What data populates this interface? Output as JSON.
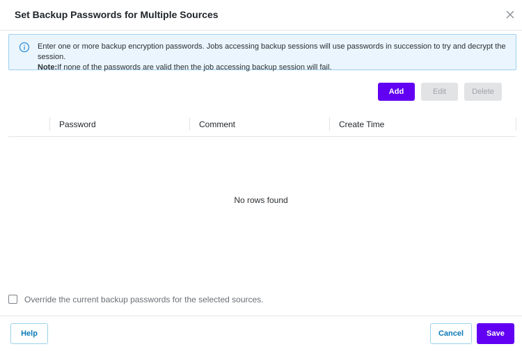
{
  "dialog": {
    "title": "Set Backup Passwords for Multiple Sources",
    "close_icon": "close-icon"
  },
  "info": {
    "icon": "info-icon",
    "line1": "Enter one or more backup encryption passwords. Jobs accessing backup sessions will use passwords in succession to try and decrypt the session.",
    "note_label": "Note:",
    "note_text": "If none of the passwords are valid then the job accessing backup session will fail.",
    "colors": {
      "background": "#eaf5fd",
      "border": "#9ed0ef",
      "icon": "#2f8fd8"
    }
  },
  "toolbar": {
    "add_label": "Add",
    "edit_label": "Edit",
    "delete_label": "Delete"
  },
  "table": {
    "columns": [
      "Password",
      "Comment",
      "Create Time"
    ],
    "rows": [],
    "empty_text": "No rows found"
  },
  "override": {
    "label": "Override the current backup passwords for the selected sources.",
    "checked": false
  },
  "footer": {
    "help_label": "Help",
    "cancel_label": "Cancel",
    "save_label": "Save"
  },
  "colors": {
    "primary": "#6100f2",
    "disabled_bg": "#e2e3e5",
    "link_blue": "#0b79b8"
  }
}
